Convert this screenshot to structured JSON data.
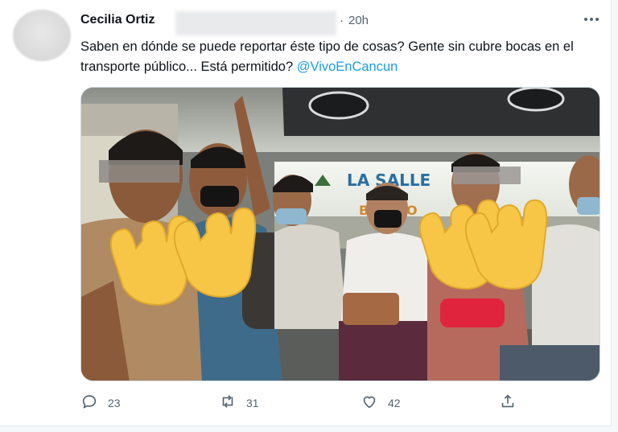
{
  "tweet": {
    "author_name": "Cecilia Ortiz",
    "separator": "·",
    "time": "20h",
    "text_main": "Saben en dónde se puede reportar éste tipo de cosas? Gente sin cubre bocas en el transporte público... Está permitido? ",
    "mention": "@VivoEnCancun",
    "bus_sign": "LA SALLE",
    "bus_sign_sub": "BL  OSIO"
  },
  "actions": {
    "reply_count": "23",
    "retweet_count": "31",
    "like_count": "42"
  },
  "icons": {
    "more": "more-horizontal-icon",
    "reply": "reply-icon",
    "retweet": "retweet-icon",
    "like": "heart-icon",
    "share": "share-icon"
  },
  "colors": {
    "accent": "#1d9bf0",
    "muted": "#536471",
    "emoji_hand": "#f7c646"
  }
}
